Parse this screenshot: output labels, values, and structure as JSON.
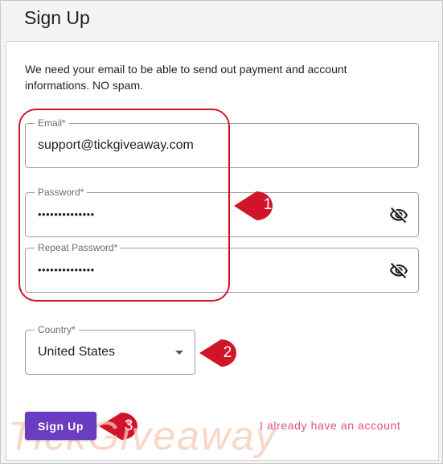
{
  "page": {
    "title": "Sign Up"
  },
  "form": {
    "intro_text": "We need your email to be able to send out payment and account informations. NO spam.",
    "email": {
      "label": "Email*",
      "value": "support@tickgiveaway.com"
    },
    "password": {
      "label": "Password*",
      "value": "••••••••••••••"
    },
    "repeat_password": {
      "label": "Repeat Password*",
      "value": "••••••••••••••"
    },
    "country": {
      "label": "Country*",
      "value": "United States"
    },
    "signup_label": "Sign Up",
    "login_link": "I already have an account"
  },
  "annotations": {
    "marker_1": "1",
    "marker_2": "2",
    "marker_3": "3",
    "color": "#d0152b"
  },
  "watermark": {
    "text": "TickGiveaway",
    "color": "#f6c9b3"
  },
  "colors": {
    "button": "#6a3cc0",
    "link": "#e0527c"
  },
  "icons": {
    "visibility_toggle": "eye-off-icon",
    "dropdown": "caret-down-icon"
  }
}
